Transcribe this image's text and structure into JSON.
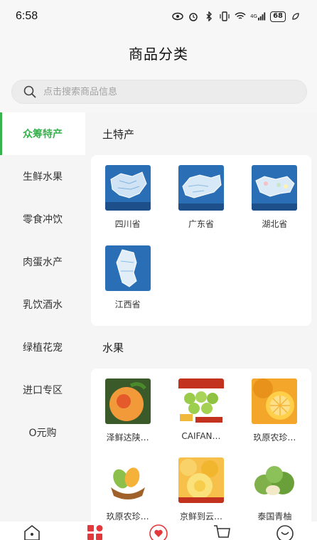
{
  "status_bar": {
    "time": "6:58",
    "battery": "68",
    "network": "4G"
  },
  "header": {
    "title": "商品分类"
  },
  "search": {
    "placeholder": "点击搜索商品信息"
  },
  "colors": {
    "accent": "#37b24d",
    "background": "#f5f5f5"
  },
  "sidebar": {
    "items": [
      {
        "label": "众筹特产",
        "active": true
      },
      {
        "label": "生鲜水果",
        "active": false
      },
      {
        "label": "零食冲饮",
        "active": false
      },
      {
        "label": "肉蛋水产",
        "active": false
      },
      {
        "label": "乳饮酒水",
        "active": false
      },
      {
        "label": "绿植花宠",
        "active": false
      },
      {
        "label": "进口专区",
        "active": false
      },
      {
        "label": "O元购",
        "active": false
      }
    ]
  },
  "sections": [
    {
      "title": "土特产",
      "items": [
        {
          "label": "四川省",
          "icon": "map-sichuan"
        },
        {
          "label": "广东省",
          "icon": "map-guangdong"
        },
        {
          "label": "湖北省",
          "icon": "map-hubei"
        },
        {
          "label": "江西省",
          "icon": "map-jiangxi"
        }
      ]
    },
    {
      "title": "水果",
      "items": [
        {
          "label": "泽鲜达陕…",
          "icon": "peach-photo"
        },
        {
          "label": "CAIFAN…",
          "icon": "plum-photo"
        },
        {
          "label": "玖原农珍…",
          "icon": "orange-photo"
        },
        {
          "label": "玖原农珍…",
          "icon": "mango-photo"
        },
        {
          "label": "京鲜到云…",
          "icon": "citrus-photo"
        },
        {
          "label": "泰国青柚",
          "icon": "pomelo-photo"
        }
      ]
    }
  ],
  "bottom_nav": [
    "home-icon",
    "category-icon",
    "heart-icon",
    "cart-icon",
    "profile-icon"
  ]
}
